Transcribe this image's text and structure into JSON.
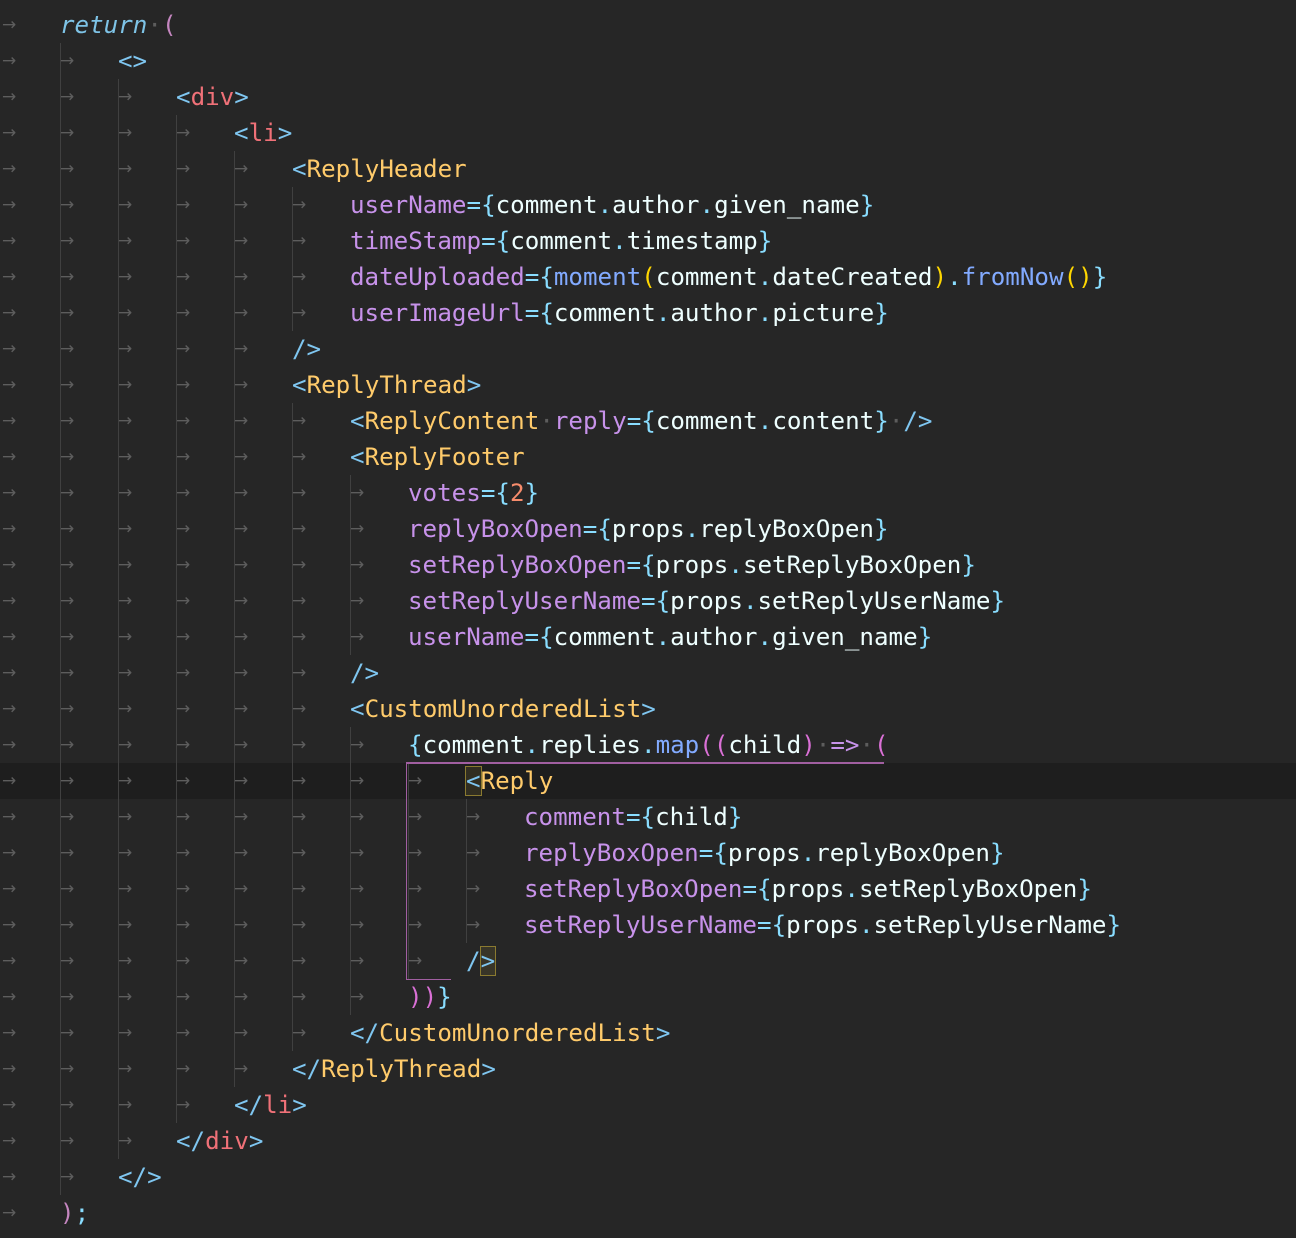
{
  "editor": {
    "active_line": 21,
    "lines": [
      {
        "indent": 1,
        "tokens": [
          [
            "return",
            "kw-return"
          ],
          [
            "·",
            "ws-dot"
          ],
          [
            "(",
            "paren-outer"
          ]
        ]
      },
      {
        "indent": 2,
        "tokens": [
          [
            "<>",
            "punct-tag"
          ]
        ]
      },
      {
        "indent": 3,
        "tokens": [
          [
            "<",
            "punct-tag"
          ],
          [
            "div",
            "tag-html"
          ],
          [
            ">",
            "punct-tag"
          ]
        ]
      },
      {
        "indent": 4,
        "tokens": [
          [
            "<",
            "punct-tag"
          ],
          [
            "li",
            "tag-html"
          ],
          [
            ">",
            "punct-tag"
          ]
        ]
      },
      {
        "indent": 5,
        "tokens": [
          [
            "<",
            "punct-tag"
          ],
          [
            "ReplyHeader",
            "tag-comp"
          ]
        ]
      },
      {
        "indent": 6,
        "tokens": [
          [
            "userName",
            "attr"
          ],
          [
            "=",
            "brace"
          ],
          [
            "{",
            "brace"
          ],
          [
            "comment",
            "var"
          ],
          [
            ".",
            "dot"
          ],
          [
            "author",
            "var"
          ],
          [
            ".",
            "dot"
          ],
          [
            "given_name",
            "var"
          ],
          [
            "}",
            "brace"
          ]
        ]
      },
      {
        "indent": 6,
        "tokens": [
          [
            "timeStamp",
            "attr"
          ],
          [
            "=",
            "brace"
          ],
          [
            "{",
            "brace"
          ],
          [
            "comment",
            "var"
          ],
          [
            ".",
            "dot"
          ],
          [
            "timestamp",
            "var"
          ],
          [
            "}",
            "brace"
          ]
        ]
      },
      {
        "indent": 6,
        "tokens": [
          [
            "dateUploaded",
            "attr"
          ],
          [
            "=",
            "brace"
          ],
          [
            "{",
            "brace"
          ],
          [
            "moment",
            "fn"
          ],
          [
            "(",
            "brk-yellow"
          ],
          [
            "comment",
            "var"
          ],
          [
            ".",
            "dot"
          ],
          [
            "dateCreated",
            "var"
          ],
          [
            ")",
            "brk-yellow"
          ],
          [
            ".",
            "dot"
          ],
          [
            "fromNow",
            "fn"
          ],
          [
            "()",
            "brk-yellow"
          ],
          [
            "}",
            "brace"
          ]
        ]
      },
      {
        "indent": 6,
        "tokens": [
          [
            "userImageUrl",
            "attr"
          ],
          [
            "=",
            "brace"
          ],
          [
            "{",
            "brace"
          ],
          [
            "comment",
            "var"
          ],
          [
            ".",
            "dot"
          ],
          [
            "author",
            "var"
          ],
          [
            ".",
            "dot"
          ],
          [
            "picture",
            "var"
          ],
          [
            "}",
            "brace"
          ]
        ]
      },
      {
        "indent": 5,
        "tokens": [
          [
            "/>",
            "punct-tag"
          ]
        ]
      },
      {
        "indent": 5,
        "tokens": [
          [
            "<",
            "punct-tag"
          ],
          [
            "ReplyThread",
            "tag-comp"
          ],
          [
            ">",
            "punct-tag"
          ]
        ]
      },
      {
        "indent": 6,
        "tokens": [
          [
            "<",
            "punct-tag"
          ],
          [
            "ReplyContent",
            "tag-comp"
          ],
          [
            "·",
            "ws-dot"
          ],
          [
            "reply",
            "attr"
          ],
          [
            "=",
            "brace"
          ],
          [
            "{",
            "brace"
          ],
          [
            "comment",
            "var"
          ],
          [
            ".",
            "dot"
          ],
          [
            "content",
            "var"
          ],
          [
            "}",
            "brace"
          ],
          [
            "·",
            "ws-dot"
          ],
          [
            "/>",
            "punct-tag"
          ]
        ]
      },
      {
        "indent": 6,
        "tokens": [
          [
            "<",
            "punct-tag"
          ],
          [
            "ReplyFooter",
            "tag-comp"
          ]
        ]
      },
      {
        "indent": 7,
        "tokens": [
          [
            "votes",
            "attr"
          ],
          [
            "=",
            "brace"
          ],
          [
            "{",
            "brace"
          ],
          [
            "2",
            "num"
          ],
          [
            "}",
            "brace"
          ]
        ]
      },
      {
        "indent": 7,
        "tokens": [
          [
            "replyBoxOpen",
            "attr"
          ],
          [
            "=",
            "brace"
          ],
          [
            "{",
            "brace"
          ],
          [
            "props",
            "var"
          ],
          [
            ".",
            "dot"
          ],
          [
            "replyBoxOpen",
            "var"
          ],
          [
            "}",
            "brace"
          ]
        ]
      },
      {
        "indent": 7,
        "tokens": [
          [
            "setReplyBoxOpen",
            "attr"
          ],
          [
            "=",
            "brace"
          ],
          [
            "{",
            "brace"
          ],
          [
            "props",
            "var"
          ],
          [
            ".",
            "dot"
          ],
          [
            "setReplyBoxOpen",
            "var"
          ],
          [
            "}",
            "brace"
          ]
        ]
      },
      {
        "indent": 7,
        "tokens": [
          [
            "setReplyUserName",
            "attr"
          ],
          [
            "=",
            "brace"
          ],
          [
            "{",
            "brace"
          ],
          [
            "props",
            "var"
          ],
          [
            ".",
            "dot"
          ],
          [
            "setReplyUserName",
            "var"
          ],
          [
            "}",
            "brace"
          ]
        ]
      },
      {
        "indent": 7,
        "tokens": [
          [
            "userName",
            "attr"
          ],
          [
            "=",
            "brace"
          ],
          [
            "{",
            "brace"
          ],
          [
            "comment",
            "var"
          ],
          [
            ".",
            "dot"
          ],
          [
            "author",
            "var"
          ],
          [
            ".",
            "dot"
          ],
          [
            "given_name",
            "var"
          ],
          [
            "}",
            "brace"
          ]
        ]
      },
      {
        "indent": 6,
        "tokens": [
          [
            "/>",
            "punct-tag"
          ]
        ]
      },
      {
        "indent": 6,
        "tokens": [
          [
            "<",
            "punct-tag"
          ],
          [
            "CustomUnorderedList",
            "tag-comp"
          ],
          [
            ">",
            "punct-tag"
          ]
        ]
      },
      {
        "indent": 7,
        "tokens": [
          [
            "{",
            "brace"
          ],
          [
            "comment",
            "var"
          ],
          [
            ".",
            "dot"
          ],
          [
            "replies",
            "var"
          ],
          [
            ".",
            "dot"
          ],
          [
            "map",
            "fn"
          ],
          [
            "(",
            "brk-pink"
          ],
          [
            "(",
            "brk-pink"
          ],
          [
            "child",
            "var"
          ],
          [
            ")",
            "brk-pink"
          ],
          [
            "·",
            "ws-dot"
          ],
          [
            "=>",
            "arrow-op"
          ],
          [
            "·",
            "ws-dot"
          ],
          [
            "(",
            "brk-pink"
          ]
        ]
      },
      {
        "indent": 8,
        "tokens": [
          [
            "<",
            "punct-tag bracket-match"
          ],
          [
            "Reply",
            "tag-comp"
          ]
        ]
      },
      {
        "indent": 9,
        "tokens": [
          [
            "comment",
            "attr"
          ],
          [
            "=",
            "brace"
          ],
          [
            "{",
            "brace"
          ],
          [
            "child",
            "var"
          ],
          [
            "}",
            "brace"
          ]
        ]
      },
      {
        "indent": 9,
        "tokens": [
          [
            "replyBoxOpen",
            "attr"
          ],
          [
            "=",
            "brace"
          ],
          [
            "{",
            "brace"
          ],
          [
            "props",
            "var"
          ],
          [
            ".",
            "dot"
          ],
          [
            "replyBoxOpen",
            "var"
          ],
          [
            "}",
            "brace"
          ]
        ]
      },
      {
        "indent": 9,
        "tokens": [
          [
            "setReplyBoxOpen",
            "attr"
          ],
          [
            "=",
            "brace"
          ],
          [
            "{",
            "brace"
          ],
          [
            "props",
            "var"
          ],
          [
            ".",
            "dot"
          ],
          [
            "setReplyBoxOpen",
            "var"
          ],
          [
            "}",
            "brace"
          ]
        ]
      },
      {
        "indent": 9,
        "tokens": [
          [
            "setReplyUserName",
            "attr"
          ],
          [
            "=",
            "brace"
          ],
          [
            "{",
            "brace"
          ],
          [
            "props",
            "var"
          ],
          [
            ".",
            "dot"
          ],
          [
            "setReplyUserName",
            "var"
          ],
          [
            "}",
            "brace"
          ]
        ]
      },
      {
        "indent": 8,
        "tokens": [
          [
            "/",
            "punct-tag"
          ],
          [
            ">",
            "punct-tag bracket-match"
          ]
        ]
      },
      {
        "indent": 7,
        "tokens": [
          [
            ")",
            "brk-pink"
          ],
          [
            ")",
            "brk-pink"
          ],
          [
            "}",
            "brace"
          ]
        ]
      },
      {
        "indent": 6,
        "tokens": [
          [
            "</",
            "punct-tag"
          ],
          [
            "CustomUnorderedList",
            "tag-comp"
          ],
          [
            ">",
            "punct-tag"
          ]
        ]
      },
      {
        "indent": 5,
        "tokens": [
          [
            "</",
            "punct-tag"
          ],
          [
            "ReplyThread",
            "tag-comp"
          ],
          [
            ">",
            "punct-tag"
          ]
        ]
      },
      {
        "indent": 4,
        "tokens": [
          [
            "</",
            "punct-tag"
          ],
          [
            "li",
            "tag-html"
          ],
          [
            ">",
            "punct-tag"
          ]
        ]
      },
      {
        "indent": 3,
        "tokens": [
          [
            "</",
            "punct-tag"
          ],
          [
            "div",
            "tag-html"
          ],
          [
            ">",
            "punct-tag"
          ]
        ]
      },
      {
        "indent": 2,
        "tokens": [
          [
            "</>",
            "punct-tag"
          ]
        ]
      },
      {
        "indent": 1,
        "tokens": [
          [
            ")",
            "paren-outer"
          ],
          [
            ";",
            "semi"
          ]
        ]
      }
    ],
    "tab_glyph": "→"
  }
}
